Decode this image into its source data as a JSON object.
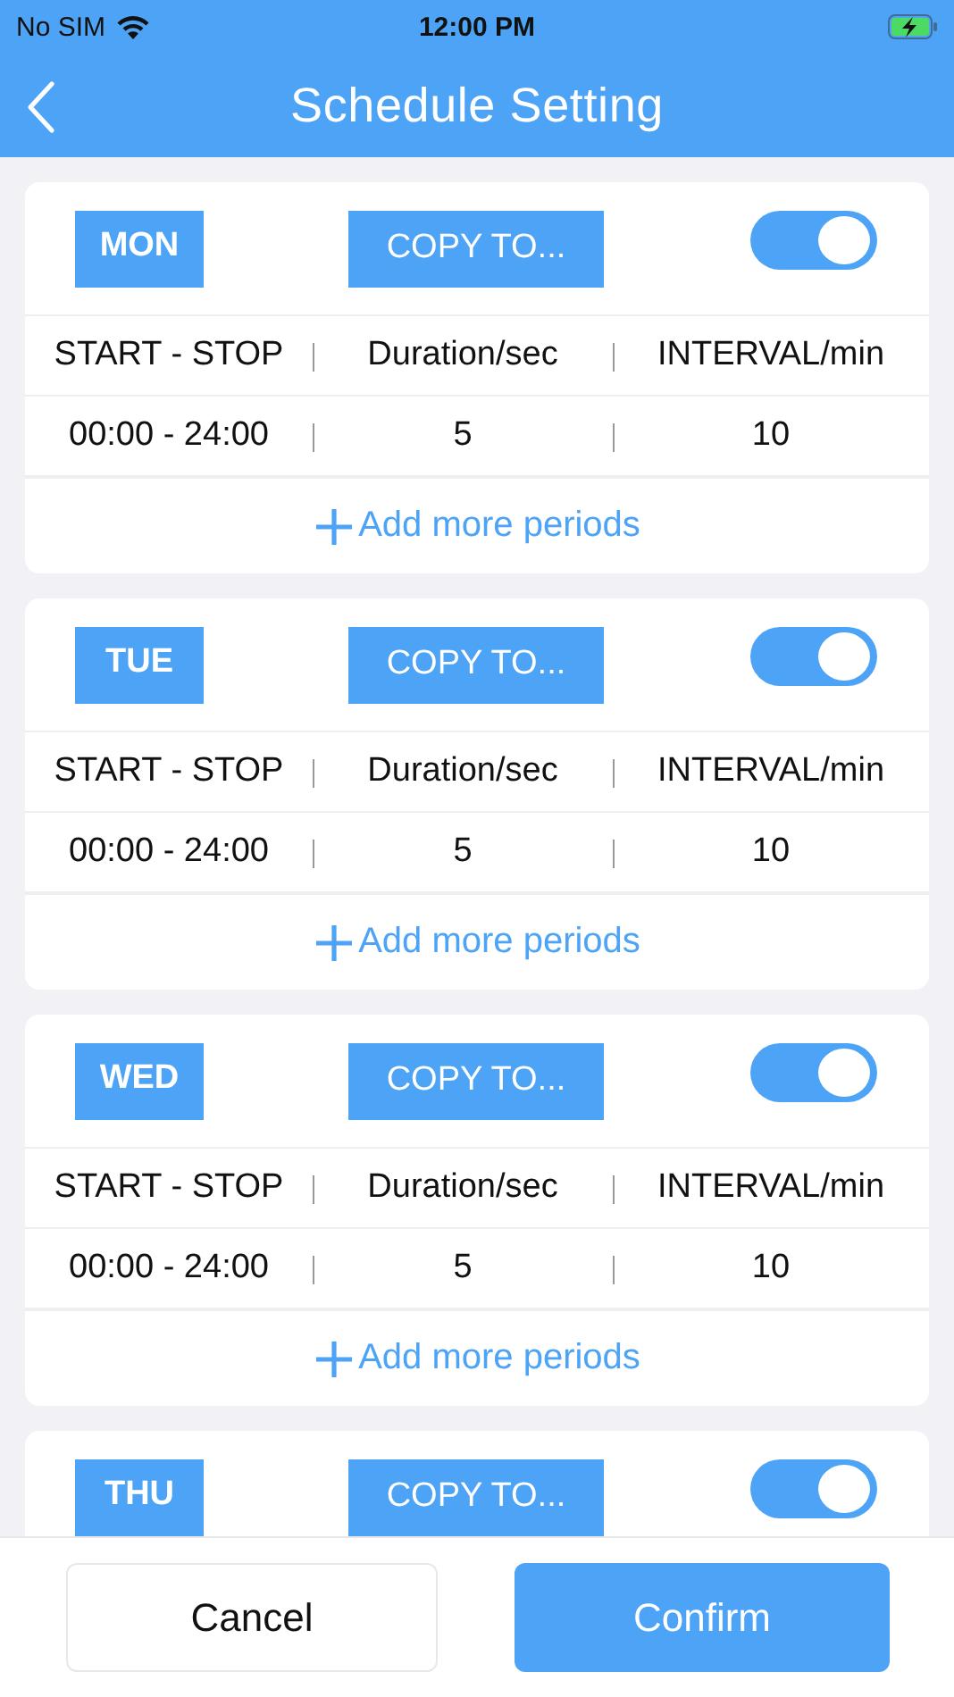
{
  "status_bar": {
    "carrier": "No SIM",
    "time": "12:00 PM"
  },
  "nav_bar": {
    "title": "Schedule Setting"
  },
  "days": [
    {
      "day": "MON",
      "copy_button": "COPY TO...",
      "enabled": true,
      "columns": [
        "START - STOP",
        "Duration/sec",
        "INTERVAL/min"
      ],
      "periods": [
        [
          "00:00 - 24:00",
          "5",
          "10"
        ]
      ],
      "add_label": "Add more periods"
    },
    {
      "day": "TUE",
      "copy_button": "COPY TO...",
      "enabled": true,
      "columns": [
        "START - STOP",
        "Duration/sec",
        "INTERVAL/min"
      ],
      "periods": [
        [
          "00:00 - 24:00",
          "5",
          "10"
        ]
      ],
      "add_label": "Add more periods"
    },
    {
      "day": "WED",
      "copy_button": "COPY TO...",
      "enabled": true,
      "columns": [
        "START - STOP",
        "Duration/sec",
        "INTERVAL/min"
      ],
      "periods": [
        [
          "00:00 - 24:00",
          "5",
          "10"
        ]
      ],
      "add_label": "Add more periods"
    },
    {
      "day": "THU",
      "copy_button": "COPY TO...",
      "enabled": true
    }
  ],
  "buttons": [
    {
      "label": "Cancel",
      "kind": "secondary"
    },
    {
      "label": "Confirm",
      "kind": "primary"
    }
  ]
}
